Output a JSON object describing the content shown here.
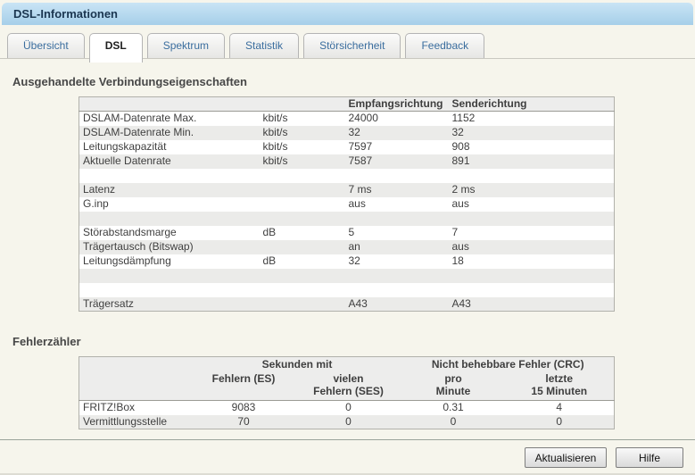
{
  "window": {
    "title": "DSL-Informationen"
  },
  "tabs": [
    {
      "label": "Übersicht",
      "active": false
    },
    {
      "label": "DSL",
      "active": true
    },
    {
      "label": "Spektrum",
      "active": false
    },
    {
      "label": "Statistik",
      "active": false
    },
    {
      "label": "Störsicherheit",
      "active": false
    },
    {
      "label": "Feedback",
      "active": false
    }
  ],
  "connection": {
    "heading": "Ausgehandelte Verbindungseigenschaften",
    "columns": {
      "rx": "Empfangsrichtung",
      "tx": "Senderichtung"
    },
    "rows": [
      {
        "label": "DSLAM-Datenrate Max.",
        "unit": "kbit/s",
        "rx": "24000",
        "tx": "1152"
      },
      {
        "label": "DSLAM-Datenrate Min.",
        "unit": "kbit/s",
        "rx": "32",
        "tx": "32"
      },
      {
        "label": "Leitungskapazität",
        "unit": "kbit/s",
        "rx": "7597",
        "tx": "908"
      },
      {
        "label": "Aktuelle Datenrate",
        "unit": "kbit/s",
        "rx": "7587",
        "tx": "891"
      },
      {
        "label": "",
        "unit": "",
        "rx": "",
        "tx": ""
      },
      {
        "label": "Latenz",
        "unit": "",
        "rx": "7 ms",
        "tx": "2 ms"
      },
      {
        "label": "G.inp",
        "unit": "",
        "rx": "aus",
        "tx": "aus"
      },
      {
        "label": "",
        "unit": "",
        "rx": "",
        "tx": ""
      },
      {
        "label": "Störabstandsmarge",
        "unit": "dB",
        "rx": "5",
        "tx": "7"
      },
      {
        "label": "Trägertausch (Bitswap)",
        "unit": "",
        "rx": "an",
        "tx": "aus"
      },
      {
        "label": "Leitungsdämpfung",
        "unit": "dB",
        "rx": "32",
        "tx": "18"
      },
      {
        "label": "",
        "unit": "",
        "rx": "",
        "tx": ""
      },
      {
        "label": "",
        "unit": "",
        "rx": "",
        "tx": ""
      },
      {
        "label": "Trägersatz",
        "unit": "",
        "rx": "A43",
        "tx": "A43"
      }
    ]
  },
  "errors": {
    "heading": "Fehlerzähler",
    "groups": {
      "seconds": "Sekunden mit",
      "crc": "Nicht behebbare Fehler (CRC)"
    },
    "columns": [
      "Fehlern (ES)",
      "vielen\nFehlern (SES)",
      "pro\nMinute",
      "letzte\n15 Minuten"
    ],
    "rows": [
      {
        "label": "FRITZ!Box",
        "values": [
          "9083",
          "0",
          "0.31",
          "4"
        ]
      },
      {
        "label": "Vermittlungsstelle",
        "values": [
          "70",
          "0",
          "0",
          "0"
        ]
      }
    ]
  },
  "footer": {
    "refresh_label": "Aktualisieren",
    "help_label": "Hilfe"
  },
  "colors": {
    "titlebar_blue": "#a6cfe9",
    "tab_link_blue": "#3a6d9e",
    "page_background": "#f6f5ec",
    "row_alt_gray": "#ebebe9",
    "table_header_gray": "#ededec"
  }
}
